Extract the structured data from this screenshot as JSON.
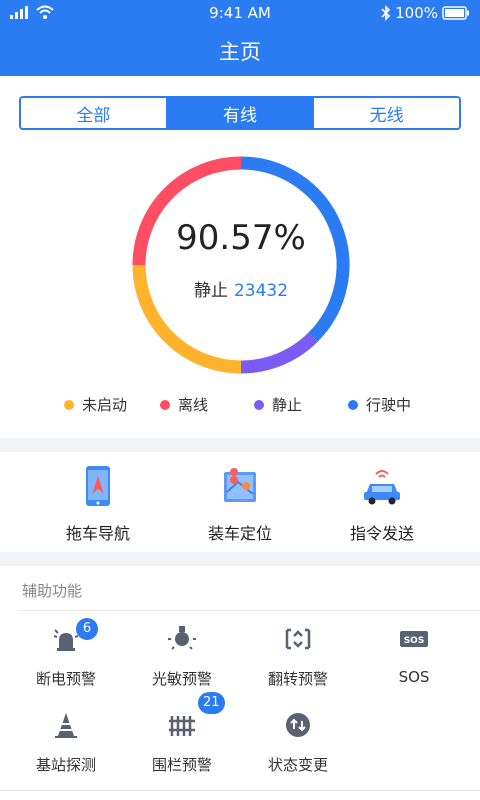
{
  "status": {
    "time": "9:41 AM",
    "battery": "100%"
  },
  "nav": {
    "title": "主页"
  },
  "segments": [
    {
      "label": "全部",
      "active": false
    },
    {
      "label": "有线",
      "active": true
    },
    {
      "label": "无线",
      "active": false
    }
  ],
  "summary": {
    "percent": "90.57%",
    "status_label": "静止",
    "status_count": "23432"
  },
  "chart_data": {
    "type": "pie",
    "slices": [
      {
        "name": "行驶中",
        "value": 37.5,
        "color": "#2b7cf3"
      },
      {
        "name": "静止",
        "value": 12.5,
        "color": "#7a5cf5"
      },
      {
        "name": "未启动",
        "value": 25,
        "color": "#ffb22c"
      },
      {
        "name": "离线",
        "value": 25,
        "color": "#ff4d63"
      }
    ]
  },
  "legend": [
    {
      "label": "未启动",
      "color": "#ffb22c"
    },
    {
      "label": "离线",
      "color": "#ff4d63"
    },
    {
      "label": "静止",
      "color": "#7a5cf5"
    },
    {
      "label": "行驶中",
      "color": "#2b7cf3"
    }
  ],
  "quick_actions": [
    {
      "label": "拖车导航",
      "icon": "phone-navigation-icon"
    },
    {
      "label": "装车定位",
      "icon": "map-location-icon"
    },
    {
      "label": "指令发送",
      "icon": "car-signal-icon"
    }
  ],
  "aux": {
    "title": "辅助功能",
    "items": [
      {
        "label": "断电预警",
        "icon": "power-alarm-icon",
        "badge": "6"
      },
      {
        "label": "光敏预警",
        "icon": "light-sensor-icon",
        "badge": ""
      },
      {
        "label": "翻转预警",
        "icon": "flip-icon",
        "badge": ""
      },
      {
        "label": "SOS",
        "icon": "sos-icon",
        "badge": ""
      },
      {
        "label": "基站探测",
        "icon": "base-station-icon",
        "badge": ""
      },
      {
        "label": "围栏预警",
        "icon": "fence-icon",
        "badge": "21"
      },
      {
        "label": "状态变更",
        "icon": "status-change-icon",
        "badge": ""
      }
    ]
  }
}
